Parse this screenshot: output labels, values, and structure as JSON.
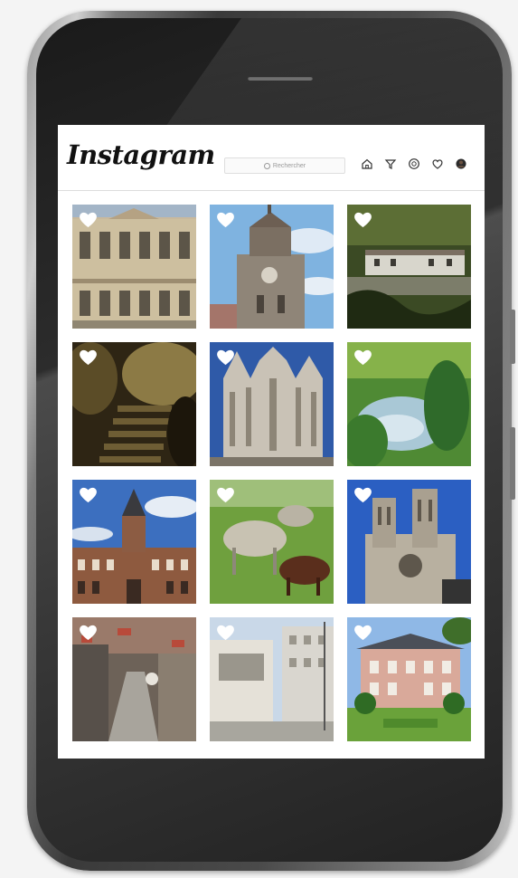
{
  "app": {
    "logo_text": "Instagram"
  },
  "search": {
    "placeholder": "Rechercher"
  },
  "nav": {
    "icons": [
      "home-icon",
      "filter-icon",
      "compass-icon",
      "heart-icon",
      "profile-avatar"
    ]
  },
  "feed": {
    "posts": [
      {
        "subject": "chateau-facade"
      },
      {
        "subject": "belfry-tower"
      },
      {
        "subject": "hillside-village"
      },
      {
        "subject": "cave-stairs"
      },
      {
        "subject": "gothic-cathedral"
      },
      {
        "subject": "green-spring"
      },
      {
        "subject": "town-hall"
      },
      {
        "subject": "goats-meadow"
      },
      {
        "subject": "cathedral-towers"
      },
      {
        "subject": "old-town-street"
      },
      {
        "subject": "white-building"
      },
      {
        "subject": "manor-garden"
      }
    ]
  },
  "colors": {
    "heart": "#ffffff",
    "text": "#111111",
    "border": "#dcdcdc"
  }
}
